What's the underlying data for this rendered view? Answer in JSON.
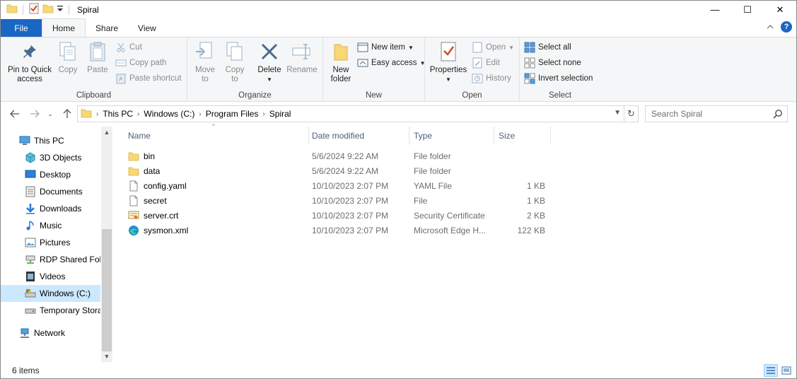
{
  "window": {
    "title": "Spiral",
    "controls": {
      "minimize": "—",
      "maximize": "☐",
      "close": "✕"
    }
  },
  "tabs": [
    {
      "label": "File"
    },
    {
      "label": "Home"
    },
    {
      "label": "Share"
    },
    {
      "label": "View"
    }
  ],
  "ribbon": {
    "clipboard": {
      "label": "Clipboard",
      "pin_line1": "Pin to Quick",
      "pin_line2": "access",
      "copy": "Copy",
      "paste": "Paste",
      "cut": "Cut",
      "copy_path": "Copy path",
      "paste_shortcut": "Paste shortcut"
    },
    "organize": {
      "label": "Organize",
      "move_to": "Move",
      "move_to_2": "to",
      "copy_to": "Copy",
      "copy_to_2": "to",
      "delete": "Delete",
      "rename": "Rename"
    },
    "new": {
      "label": "New",
      "new_folder_1": "New",
      "new_folder_2": "folder",
      "new_item": "New item",
      "easy_access": "Easy access"
    },
    "open": {
      "label": "Open",
      "properties": "Properties",
      "open": "Open",
      "edit": "Edit",
      "history": "History"
    },
    "select": {
      "label": "Select",
      "select_all": "Select all",
      "select_none": "Select none",
      "invert_selection": "Invert selection"
    }
  },
  "address": {
    "crumbs": [
      "This PC",
      "Windows (C:)",
      "Program Files",
      "Spiral"
    ],
    "search_placeholder": "Search Spiral"
  },
  "nav": {
    "items": [
      {
        "label": "This PC",
        "icon": "computer-icon"
      },
      {
        "label": "3D Objects",
        "icon": "3d-objects-icon"
      },
      {
        "label": "Desktop",
        "icon": "desktop-icon"
      },
      {
        "label": "Documents",
        "icon": "documents-icon"
      },
      {
        "label": "Downloads",
        "icon": "downloads-icon"
      },
      {
        "label": "Music",
        "icon": "music-icon"
      },
      {
        "label": "Pictures",
        "icon": "pictures-icon"
      },
      {
        "label": "RDP Shared Fold",
        "icon": "network-drive-icon"
      },
      {
        "label": "Videos",
        "icon": "videos-icon"
      },
      {
        "label": "Windows (C:)",
        "icon": "drive-icon"
      },
      {
        "label": "Temporary Stora",
        "icon": "drive-icon"
      },
      {
        "label": "Network",
        "icon": "network-icon"
      }
    ]
  },
  "columns": {
    "name": "Name",
    "date": "Date modified",
    "type": "Type",
    "size": "Size"
  },
  "files": [
    {
      "name": "bin",
      "date": "5/6/2024 9:22 AM",
      "type": "File folder",
      "size": "",
      "icon": "folder-icon"
    },
    {
      "name": "data",
      "date": "5/6/2024 9:22 AM",
      "type": "File folder",
      "size": "",
      "icon": "folder-icon"
    },
    {
      "name": "config.yaml",
      "date": "10/10/2023 2:07 PM",
      "type": "YAML File",
      "size": "1 KB",
      "icon": "file-icon"
    },
    {
      "name": "secret",
      "date": "10/10/2023 2:07 PM",
      "type": "File",
      "size": "1 KB",
      "icon": "file-icon"
    },
    {
      "name": "server.crt",
      "date": "10/10/2023 2:07 PM",
      "type": "Security Certificate",
      "size": "2 KB",
      "icon": "certificate-icon"
    },
    {
      "name": "sysmon.xml",
      "date": "10/10/2023 2:07 PM",
      "type": "Microsoft Edge H...",
      "size": "122 KB",
      "icon": "edge-icon"
    }
  ],
  "status": {
    "item_count": "6 items"
  },
  "colors": {
    "accent": "#1a66c4",
    "selection": "#cce8ff",
    "folder": "#f8d775"
  }
}
